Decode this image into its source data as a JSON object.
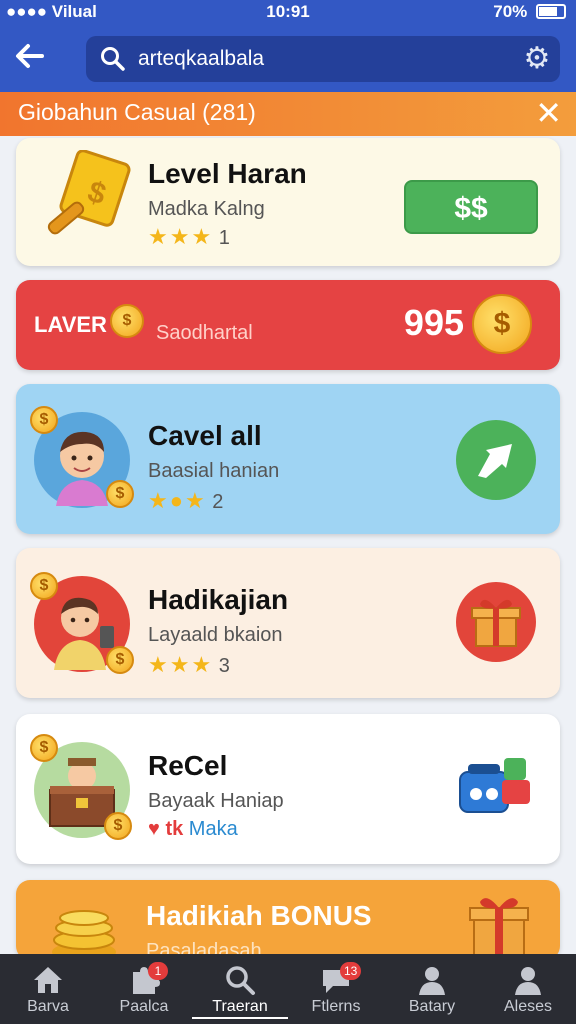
{
  "status_bar": {
    "left": "●●●● Vilual",
    "time": "10:91",
    "right": "70%"
  },
  "search": {
    "value": "arteqkaalbala"
  },
  "category_banner": {
    "title": "Giobahun  Casual (281)"
  },
  "cards": [
    {
      "title": "Level Haran",
      "subtitle": "Madka Kalng",
      "rating_count": "1",
      "action_label": "$$"
    },
    {
      "brand": "LAVER",
      "subtitle": "Saodhartal",
      "value": "995"
    },
    {
      "title": "Cavel all",
      "subtitle": "Baasial hanian",
      "rating_count": "2"
    },
    {
      "title": "Hadikajian",
      "subtitle": "Layaald bkaion",
      "rating_count": "3"
    },
    {
      "title": "ReCel",
      "subtitle": "Bayaak Haniap",
      "tag_a": "tk",
      "tag_b": "Maka"
    },
    {
      "title": "Hadikiah BONUS",
      "subtitle": "Pasaladasah"
    }
  ],
  "bottom_nav": [
    {
      "label": "Barva",
      "icon": "home-icon"
    },
    {
      "label": "Paalca",
      "icon": "puzzle-icon",
      "badge": "1"
    },
    {
      "label": "Traeran",
      "icon": "search-icon"
    },
    {
      "label": "Ftlerns",
      "icon": "chat-icon",
      "badge": "13"
    },
    {
      "label": "Batary",
      "icon": "person-icon"
    },
    {
      "label": "Aleses",
      "icon": "profile-icon"
    }
  ],
  "colors": {
    "header_blue": "#3358c4",
    "banner_orange": "#f1752e",
    "card_red": "#e54343",
    "card_blue": "#9fd4f3",
    "card_orange": "#f5a43a",
    "green_button": "#4cb25a"
  }
}
